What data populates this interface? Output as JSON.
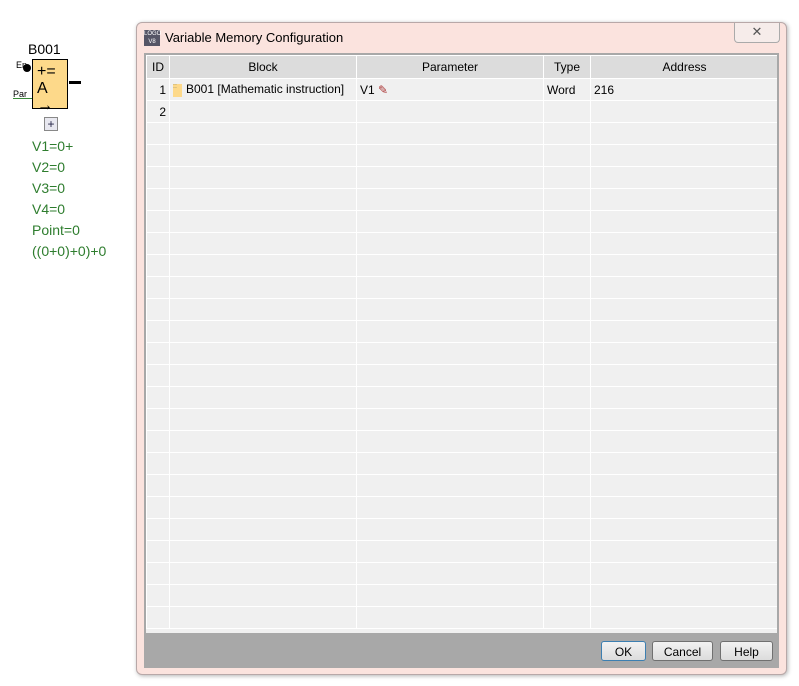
{
  "diagram": {
    "block_name": "B001",
    "en_label": "En",
    "par_label": "Par",
    "symbol_top": "+=",
    "symbol_bottom": "A →",
    "values": [
      "V1=0+",
      "V2=0",
      "V3=0",
      "V4=0",
      "Point=0",
      "((0+0)+0)+0"
    ]
  },
  "dialog": {
    "title": "Variable Memory Configuration",
    "close": "✕",
    "columns": [
      "ID",
      "Block",
      "Parameter",
      "Type",
      "Address"
    ],
    "rows": [
      {
        "id": "1",
        "block": "B001 [Mathematic instruction]",
        "parameter": "V1",
        "type": "Word",
        "address": "216"
      },
      {
        "id": "2",
        "block": "",
        "parameter": "",
        "type": "",
        "address": ""
      }
    ],
    "buttons": {
      "ok": "OK",
      "cancel": "Cancel",
      "help": "Help"
    }
  }
}
